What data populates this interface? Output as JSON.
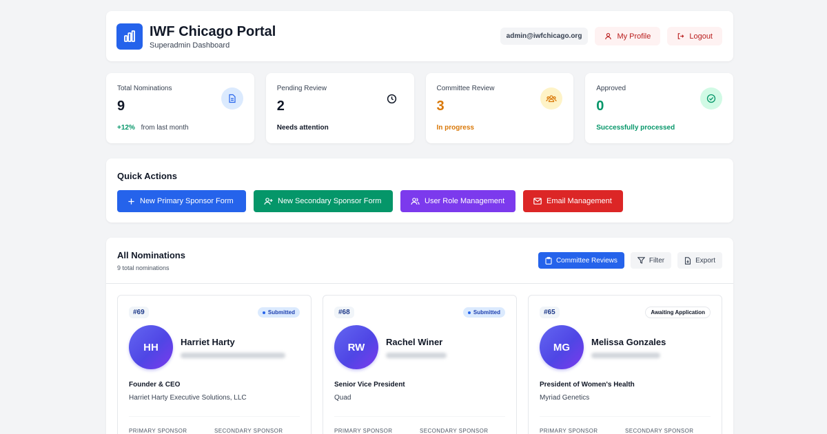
{
  "header": {
    "title": "IWF Chicago Portal",
    "subtitle": "Superadmin Dashboard",
    "email": "admin@iwfchicago.org",
    "profile_label": "My Profile",
    "logout_label": "Logout"
  },
  "stats": [
    {
      "label": "Total Nominations",
      "value": "9",
      "delta": "+12%",
      "foot": "from last month",
      "color": "#111827",
      "foot_color": "#059669"
    },
    {
      "label": "Pending Review",
      "value": "2",
      "foot": "Needs attention",
      "color": "#111827",
      "foot_color": "#111827"
    },
    {
      "label": "Committee Review",
      "value": "3",
      "foot": "In progress",
      "color": "#d97706",
      "foot_color": "#d97706"
    },
    {
      "label": "Approved",
      "value": "0",
      "foot": "Successfully processed",
      "color": "#059669",
      "foot_color": "#059669"
    }
  ],
  "quick_actions": {
    "title": "Quick Actions",
    "buttons": [
      {
        "label": "New Primary Sponsor Form",
        "color": "#2563eb"
      },
      {
        "label": "New Secondary Sponsor Form",
        "color": "#059669"
      },
      {
        "label": "User Role Management",
        "color": "#7c3aed"
      },
      {
        "label": "Email Management",
        "color": "#dc2626"
      }
    ]
  },
  "nominations": {
    "title": "All Nominations",
    "subtitle": "9 total nominations",
    "committee_label": "Committee Reviews",
    "filter_label": "Filter",
    "export_label": "Export",
    "primary_label": "PRIMARY SPONSOR",
    "secondary_label": "SECONDARY SPONSOR",
    "cards": [
      {
        "id": "#69",
        "status": "Submitted",
        "initials": "HH",
        "name": "Harriet Harty",
        "title": "Founder & CEO",
        "org": "Harriet Harty Executive Solutions, LLC"
      },
      {
        "id": "#68",
        "status": "Submitted",
        "initials": "RW",
        "name": "Rachel Winer",
        "title": "Senior Vice President",
        "org": "Quad"
      },
      {
        "id": "#65",
        "status": "Awaiting Application",
        "initials": "MG",
        "name": "Melissa Gonzales",
        "title": "President of Women's Health",
        "org": "Myriad Genetics"
      }
    ]
  }
}
